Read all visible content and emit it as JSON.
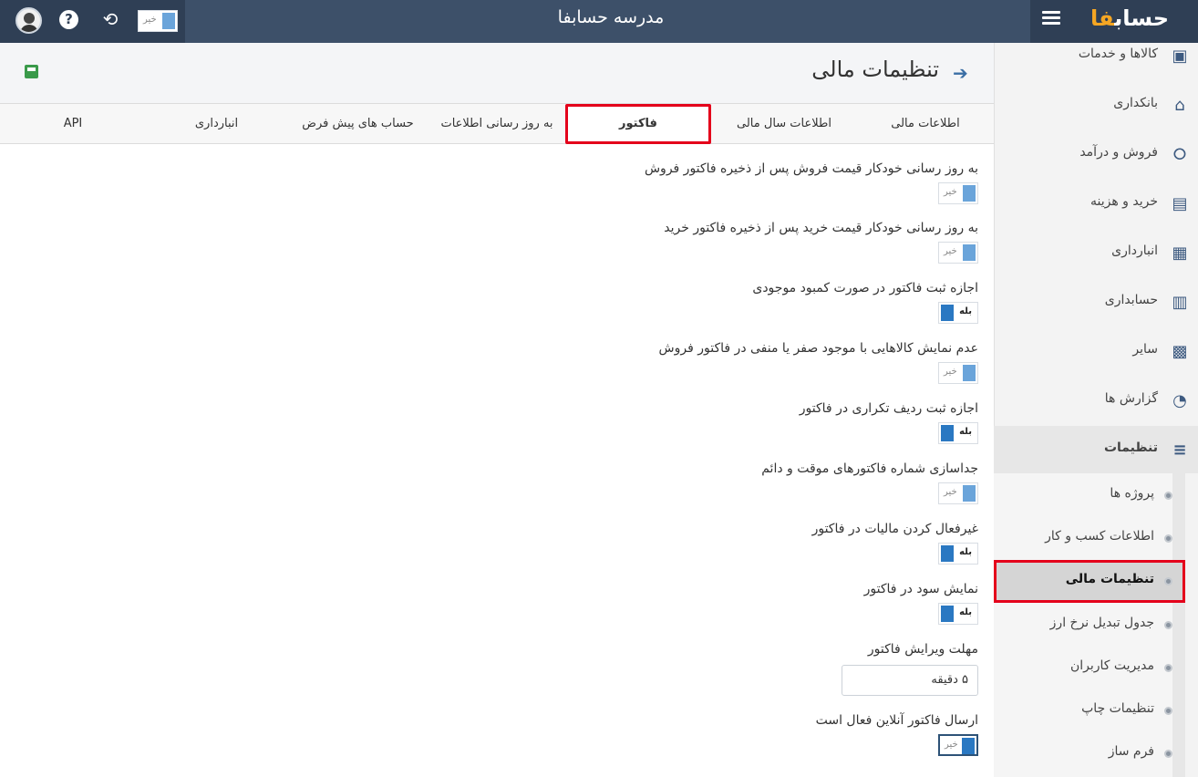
{
  "topbar": {
    "title": "مدرسه حسابفا",
    "logo_main": "حساب",
    "logo_accent": "فا",
    "toggle_label": "خیر",
    "icons": {
      "avatar": "user-avatar",
      "help": "question-icon",
      "sync": "sync-icon",
      "menu": "hamburger-icon"
    }
  },
  "header": {
    "title": "تنظیمات مالی",
    "back_icon": "arrow-right-icon",
    "save_icon": "save-icon"
  },
  "tabs": [
    {
      "label": "اطلاعات مالی"
    },
    {
      "label": "اطلاعات سال مالی"
    },
    {
      "label": "فاکتور"
    },
    {
      "label": "به روز رسانی اطلاعات"
    },
    {
      "label": "حساب های پیش فرض"
    },
    {
      "label": "انبارداری"
    },
    {
      "label": "API"
    }
  ],
  "active_tab": "فاکتور",
  "settings": [
    {
      "label": "به روز رسانی خودکار قیمت فروش پس از ذخیره فاکتور فروش",
      "value": "خیر"
    },
    {
      "label": "به روز رسانی خودکار قیمت خرید پس از ذخیره فاکتور خرید",
      "value": "خیر"
    },
    {
      "label": "اجازه ثبت فاکتور در صورت کمبود موجودی",
      "value": "بله"
    },
    {
      "label": "عدم نمایش کالاهایی با موجود صفر یا منفی در فاکتور فروش",
      "value": "خیر"
    },
    {
      "label": "اجازه ثبت ردیف تکراری در فاکتور",
      "value": "بله"
    },
    {
      "label": "جداسازی شماره فاکتورهای موقت و دائم",
      "value": "خیر"
    },
    {
      "label": "غیرفعال کردن مالیات در فاکتور",
      "value": "بله"
    },
    {
      "label": "نمایش سود در فاکتور",
      "value": "بله"
    },
    {
      "label": "مهلت ویرایش فاکتور",
      "value": "۵ دقیقه"
    },
    {
      "label": "ارسال فاکتور آنلاین فعال است",
      "value": "خیر"
    }
  ],
  "sidebar": {
    "items": [
      {
        "label": "کالاها و خدمات",
        "icon": "box-icon"
      },
      {
        "label": "بانکداری",
        "icon": "bank-icon"
      },
      {
        "label": "فروش و درآمد",
        "icon": "money-hand-icon"
      },
      {
        "label": "خرید و هزینه",
        "icon": "wallet-icon"
      },
      {
        "label": "انبارداری",
        "icon": "warehouse-icon"
      },
      {
        "label": "حسابداری",
        "icon": "abacus-icon"
      },
      {
        "label": "سایر",
        "icon": "grid-icon"
      },
      {
        "label": "گزارش ها",
        "icon": "chart-icon"
      },
      {
        "label": "تنظیمات",
        "icon": "sliders-icon"
      }
    ],
    "subitems": [
      {
        "label": "پروژه ها"
      },
      {
        "label": "اطلاعات کسب و کار"
      },
      {
        "label": "تنظیمات مالی"
      },
      {
        "label": "جدول تبدیل نرخ ارز"
      },
      {
        "label": "مدیریت کاربران"
      },
      {
        "label": "تنظیمات چاپ"
      },
      {
        "label": "فرم ساز"
      }
    ]
  },
  "colors": {
    "topbar": "#3d5069",
    "accent": "#2a78c2",
    "highlight": "#e4001b",
    "logo_accent": "#f5a623"
  },
  "side_panel_icon": "copy-icon"
}
